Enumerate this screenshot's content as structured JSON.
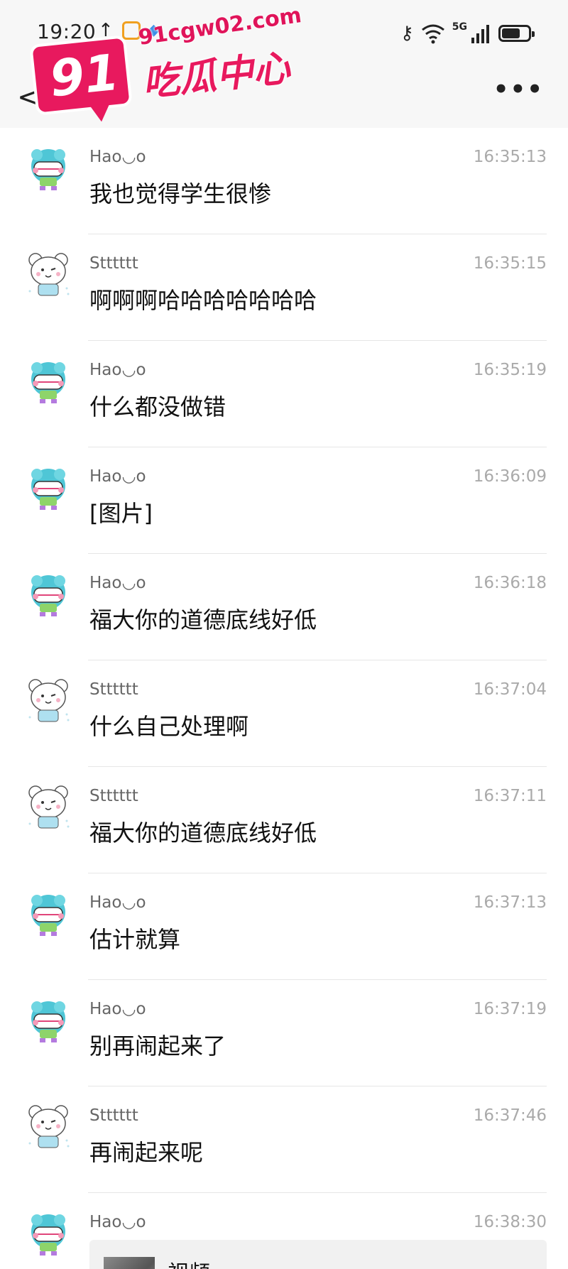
{
  "status_bar": {
    "time": "19:20",
    "upload_icon": "upload-arrow-icon",
    "network_label": "5G"
  },
  "title_bar": {
    "back_icon": "chevron-left-icon",
    "more_icon": "more-dots-icon"
  },
  "watermark": {
    "url": "91cgw02.com",
    "number": "91",
    "name": "吃瓜中心",
    "color": "#e8195e"
  },
  "messages": [
    {
      "sender": "Hao◡o",
      "time": "16:35:13",
      "text": "我也觉得学生很惨",
      "avatar": "avatar-fishbowl"
    },
    {
      "sender": "Stttttt",
      "time": "16:35:15",
      "text": "啊啊啊哈哈哈哈哈哈哈",
      "avatar": "avatar-bear"
    },
    {
      "sender": "Hao◡o",
      "time": "16:35:19",
      "text": "什么都没做错",
      "avatar": "avatar-fishbowl"
    },
    {
      "sender": "Hao◡o",
      "time": "16:36:09",
      "text": "[图片]",
      "avatar": "avatar-fishbowl"
    },
    {
      "sender": "Hao◡o",
      "time": "16:36:18",
      "text": "福大你的道德底线好低",
      "avatar": "avatar-fishbowl"
    },
    {
      "sender": "Stttttt",
      "time": "16:37:04",
      "text": "什么自己处理啊",
      "avatar": "avatar-bear"
    },
    {
      "sender": "Stttttt",
      "time": "16:37:11",
      "text": "福大你的道德底线好低",
      "avatar": "avatar-bear"
    },
    {
      "sender": "Hao◡o",
      "time": "16:37:13",
      "text": "估计就算",
      "avatar": "avatar-fishbowl"
    },
    {
      "sender": "Hao◡o",
      "time": "16:37:19",
      "text": "别再闹起来了",
      "avatar": "avatar-fishbowl"
    },
    {
      "sender": "Stttttt",
      "time": "16:37:46",
      "text": "再闹起来呢",
      "avatar": "avatar-bear"
    },
    {
      "sender": "Hao◡o",
      "time": "16:38:30",
      "video_label": "视频",
      "avatar": "avatar-fishbowl"
    }
  ]
}
